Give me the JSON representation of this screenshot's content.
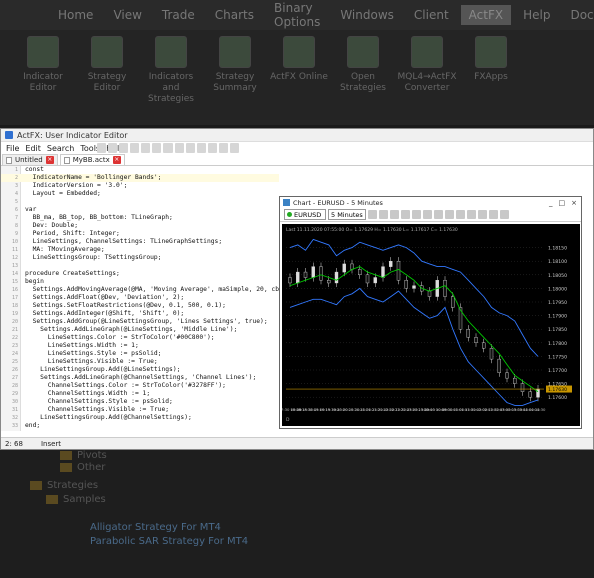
{
  "background_app": {
    "menu": [
      "Home",
      "View",
      "Trade",
      "Charts",
      "Binary Options",
      "Windows",
      "Client",
      "ActFX",
      "Help",
      "Docs"
    ],
    "active_menu": "ActFX",
    "ribbon_tools": [
      {
        "label": "Indicator Editor"
      },
      {
        "label": "Strategy Editor"
      },
      {
        "label": "Indicators and Strategies"
      },
      {
        "label": "Strategy Summary"
      },
      {
        "label": "ActFX Online"
      },
      {
        "label": "Open Strategies"
      },
      {
        "label": "MQL4→ActFX Converter"
      },
      {
        "label": "FXApps"
      }
    ],
    "ribbon_group": "ActFX",
    "tree": {
      "items": [
        "Pivots",
        "Other",
        "Strategies",
        "Samples"
      ],
      "sub_items": [
        "Alligator Strategy For MT4",
        "Parabolic SAR Strategy For MT4"
      ]
    }
  },
  "editor": {
    "title": "ActFX: User Indicator Editor",
    "menu": [
      "File",
      "Edit",
      "Search",
      "Tools",
      "Help"
    ],
    "tabs": [
      {
        "label": "Untitled",
        "active": false
      },
      {
        "label": "MyBB.actx",
        "active": true
      }
    ],
    "code_lines": [
      "const",
      "  IndicatorName = 'Bollinger Bands';",
      "  IndicatorVersion = '3.0';",
      "  Layout = Embedded;",
      "",
      "var",
      "  BB_ma, BB_top, BB_bottom: TLineGraph;",
      "  Dev: Double;",
      "  Period, Shift: Integer;",
      "  LineSettings, ChannelSettings: TLineGraphSettings;",
      "  MA: TMovingAverage;",
      "  LineSettingsGroup: TSettingsGroup;",
      "",
      "procedure CreateSettings;",
      "begin",
      "  Settings.AddMovingAverage(@MA, 'Moving Average', maSimple, 20, cb",
      "  Settings.AddFloat(@Dev, 'Deviation', 2);",
      "  Settings.SetFloatRestrictions(@Dev, 0.1, 500, 0.1);",
      "  Settings.AddInteger(@Shift, 'Shift', 0);",
      "  Settings.AddGroup(@LineSettingsGroup, 'Lines Settings', true);",
      "    Settings.AddLineGraph(@LineSettings, 'Middle Line');",
      "      LineSettings.Color := StrToColor('#00C800');",
      "      LineSettings.Width := 1;",
      "      LineSettings.Style := psSolid;",
      "      LineSettings.Visible := True;",
      "    LineSettingsGroup.Add(@LineSettings);",
      "    Settings.AddLineGraph(@ChannelSettings, 'Channel Lines');",
      "      ChannelSettings.Color := StrToColor('#3278FF');",
      "      ChannelSettings.Width := 1;",
      "      ChannelSettings.Style := psSolid;",
      "      ChannelSettings.Visible := True;",
      "    LineSettingsGroup.Add(@ChannelSettings);",
      "end;"
    ],
    "status": {
      "position": "2: 68",
      "mode": "Insert"
    }
  },
  "chart_window": {
    "title": "Chart - EURUSD - 5 Minutes",
    "symbol": "EURUSD",
    "timeframe": "5 Minutes",
    "controls": [
      "_",
      "□",
      "×"
    ],
    "info_line": "Last 11.11.2020 07:55:00 O= 1.17629 H= 1.17630 L= 1.17617 C= 1.17630",
    "price_labels": [
      "1.18150",
      "1.18100",
      "1.18050",
      "1.18000",
      "1.17950",
      "1.17900",
      "1.17850",
      "1.17800",
      "1.17750",
      "1.17700",
      "1.17650",
      "1.17600"
    ],
    "current_price": "1.17630",
    "time_labels": [
      "17:30 09.09",
      "18:00",
      "18:15",
      "18:30",
      "18:45",
      "19:00",
      "19:15",
      "19:30",
      "19:45",
      "20:00",
      "20:15",
      "20:30",
      "20:45",
      "21:00",
      "21:15",
      "21:30",
      "21:45",
      "22:00",
      "22:15",
      "22:30",
      "22:45",
      "23:00",
      "23:15",
      "23:30",
      "23:45",
      "00:00 10.09",
      "00:15",
      "00:30",
      "00:45",
      "01:00",
      "01:15",
      "01:30",
      "01:45",
      "02:00",
      "02:15",
      "02:30",
      "02:45",
      "03:00",
      "03:15",
      "03:30",
      "03:45",
      "04:00",
      "04:15",
      "04:30"
    ],
    "bottom_label": "D",
    "colors": {
      "candles_up": "#dddddd",
      "candles_down": "#bbbbbb",
      "middle_line": "#00C800",
      "channel_lines": "#3278FF",
      "price_line": "#c89600",
      "grid": "#333333",
      "background": "#000000"
    }
  },
  "chart_data": {
    "type": "line",
    "title": "",
    "xlabel": "",
    "ylabel": "",
    "ylim": [
      1.17575,
      1.182
    ],
    "series": [
      {
        "name": "",
        "values": [
          1.1801,
          1.1802,
          1.1803,
          1.1804,
          1.1805,
          1.1804,
          1.1803,
          1.1805,
          1.1807,
          1.1808,
          1.1806,
          1.1805,
          1.1804,
          1.1806,
          1.1807,
          1.1805,
          1.1803,
          1.18,
          1.1799,
          1.18,
          1.1801,
          1.1798,
          1.1792,
          1.1788,
          1.1785,
          1.1782,
          1.1779,
          1.1776,
          1.1772,
          1.1768,
          1.1766,
          1.1764,
          1.1762
        ]
      },
      {
        "name": "",
        "values": [
          1.1815,
          1.1816,
          1.1814,
          1.1818,
          1.1817,
          1.1816,
          1.1812,
          1.1814,
          1.1815,
          1.1817,
          1.1816,
          1.1815,
          1.1814,
          1.1815,
          1.1816,
          1.1815,
          1.1813,
          1.181,
          1.1809,
          1.1808,
          1.1808,
          1.1807,
          1.1806,
          1.1803,
          1.18,
          1.1797,
          1.1793,
          1.1791,
          1.179,
          1.1788,
          1.1783,
          1.1778,
          1.1775
        ]
      },
      {
        "name": "",
        "values": [
          1.1793,
          1.1794,
          1.1795,
          1.1796,
          1.1796,
          1.1795,
          1.1794,
          1.1797,
          1.1798,
          1.18,
          1.1797,
          1.1796,
          1.1795,
          1.1797,
          1.1799,
          1.1796,
          1.1793,
          1.1791,
          1.1789,
          1.179,
          1.1793,
          1.1785,
          1.1778,
          1.1773,
          1.177,
          1.1767,
          1.1764,
          1.1761,
          1.1758,
          1.1757,
          1.1757,
          1.1758,
          1.1759
        ]
      },
      {
        "name": "",
        "values": [
          1.1802,
          1.1806,
          1.1804,
          1.1808,
          1.1803,
          1.1802,
          1.1806,
          1.1809,
          1.1807,
          1.1805,
          1.1802,
          1.1804,
          1.1808,
          1.181,
          1.1803,
          1.18,
          1.1801,
          1.1799,
          1.1797,
          1.1803,
          1.1797,
          1.1793,
          1.1785,
          1.1782,
          1.178,
          1.1778,
          1.1774,
          1.1769,
          1.1767,
          1.1765,
          1.1762,
          1.176,
          1.1763
        ]
      }
    ]
  }
}
